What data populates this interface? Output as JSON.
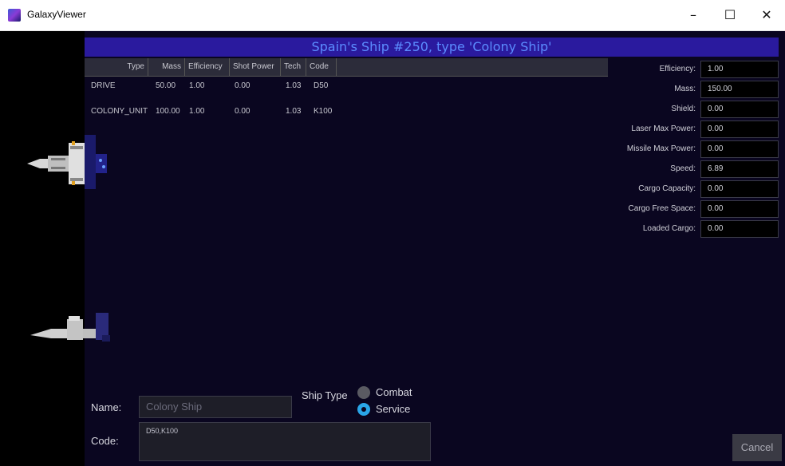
{
  "window": {
    "title": "GalaxyViewer",
    "minimize_glyph": "–",
    "maximize_glyph": "☐",
    "close_glyph": "✕",
    "icon": "galaxy-app-icon"
  },
  "header": {
    "title": "Spain's Ship  #250, type 'Colony Ship'"
  },
  "components_table": {
    "columns": [
      "Type",
      "Mass",
      "Efficiency",
      "Shot Power",
      "Tech",
      "Code"
    ],
    "rows": [
      {
        "type": "DRIVE",
        "mass": "50.00",
        "efficiency": "1.00",
        "shot_power": "0.00",
        "tech": "1.03",
        "code": "D50"
      },
      {
        "type": "COLONY_UNIT",
        "mass": "100.00",
        "efficiency": "1.00",
        "shot_power": "0.00",
        "tech": "1.03",
        "code": "K100"
      }
    ]
  },
  "stats": [
    {
      "label": "Efficiency:",
      "value": "1.00"
    },
    {
      "label": "Mass:",
      "value": "150.00"
    },
    {
      "label": "Shield:",
      "value": "0.00"
    },
    {
      "label": "Laser Max Power:",
      "value": "0.00"
    },
    {
      "label": "Missile Max Power:",
      "value": "0.00"
    },
    {
      "label": "Speed:",
      "value": "6.89"
    },
    {
      "label": "Cargo Capacity:",
      "value": "0.00"
    },
    {
      "label": "Cargo Free Space:",
      "value": "0.00"
    },
    {
      "label": "Loaded Cargo:",
      "value": "0.00"
    }
  ],
  "form": {
    "name_label": "Name:",
    "name_placeholder": "Colony Ship",
    "code_label": "Code:",
    "code_value": "D50,K100",
    "ship_type_label": "Ship Type",
    "ship_type_options": [
      {
        "label": "Combat",
        "selected": false
      },
      {
        "label": "Service",
        "selected": true
      }
    ],
    "cancel_label": "Cancel"
  },
  "colors": {
    "header_bg": "#2a1a9e",
    "header_text": "#5b8cff",
    "panel_bg": "#0a0620",
    "radio_selected": "#2aa6e8"
  }
}
